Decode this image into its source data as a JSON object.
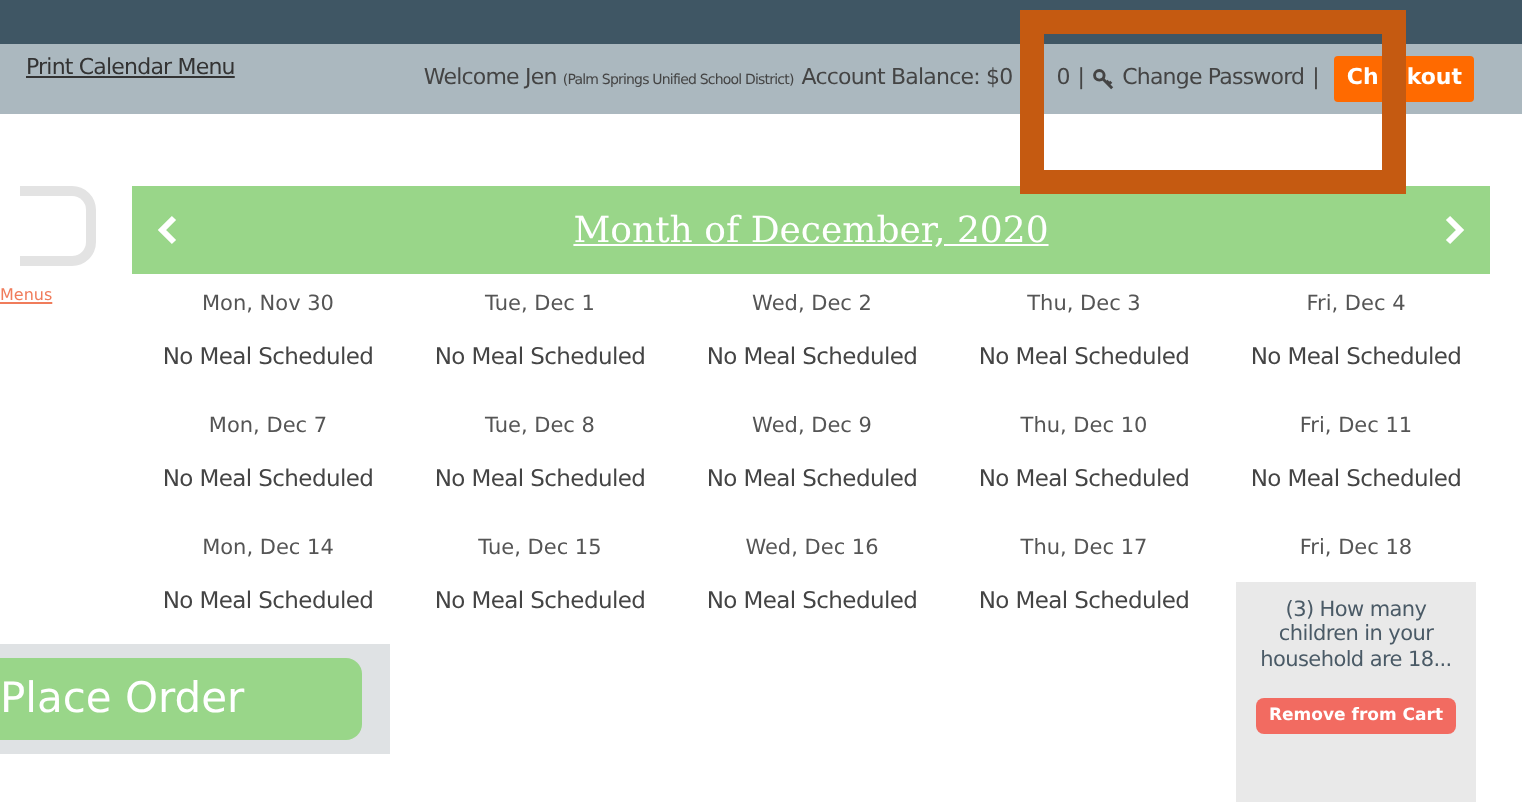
{
  "header": {
    "print_link": "Print Calendar Menu",
    "welcome": "Welcome Jen",
    "district": "(Palm Springs Unified School District)",
    "balance": "Account Balance: $0",
    "balance_tail": "0",
    "separators": [
      "|",
      "|"
    ],
    "change_password": "Change Password",
    "checkout": "Ch",
    "checkout_tail": "kout"
  },
  "sidebar": {
    "link": "Menus"
  },
  "calendar": {
    "title": "Month of December, 2020",
    "days": [
      {
        "kind": "empty",
        "date": "Mon, Nov 30",
        "text": "No Meal Scheduled"
      },
      {
        "kind": "empty",
        "date": "Tue, Dec 1",
        "text": "No Meal Scheduled"
      },
      {
        "kind": "empty",
        "date": "Wed, Dec 2",
        "text": "No Meal Scheduled"
      },
      {
        "kind": "empty",
        "date": "Thu, Dec 3",
        "text": "No Meal Scheduled"
      },
      {
        "kind": "empty",
        "date": "Fri, Dec 4",
        "text": "No Meal Scheduled"
      },
      {
        "kind": "empty",
        "date": "Mon, Dec 7",
        "text": "No Meal Scheduled"
      },
      {
        "kind": "empty",
        "date": "Tue, Dec 8",
        "text": "No Meal Scheduled"
      },
      {
        "kind": "empty",
        "date": "Wed, Dec 9",
        "text": "No Meal Scheduled"
      },
      {
        "kind": "empty",
        "date": "Thu, Dec 10",
        "text": "No Meal Scheduled"
      },
      {
        "kind": "empty",
        "date": "Fri, Dec 11",
        "text": "No Meal Scheduled"
      },
      {
        "kind": "empty",
        "date": "Mon, Dec 14",
        "text": "No Meal Scheduled"
      },
      {
        "kind": "empty",
        "date": "Tue, Dec 15",
        "text": "No Meal Scheduled"
      },
      {
        "kind": "empty",
        "date": "Wed, Dec 16",
        "text": "No Meal Scheduled"
      },
      {
        "kind": "empty",
        "date": "Thu, Dec 17",
        "text": "No Meal Scheduled"
      },
      {
        "kind": "cart",
        "date": "Fri, Dec 18",
        "question": "(3) How many children in your household are 18...",
        "button": "Remove from Cart"
      }
    ]
  },
  "place_order": "Place Order"
}
